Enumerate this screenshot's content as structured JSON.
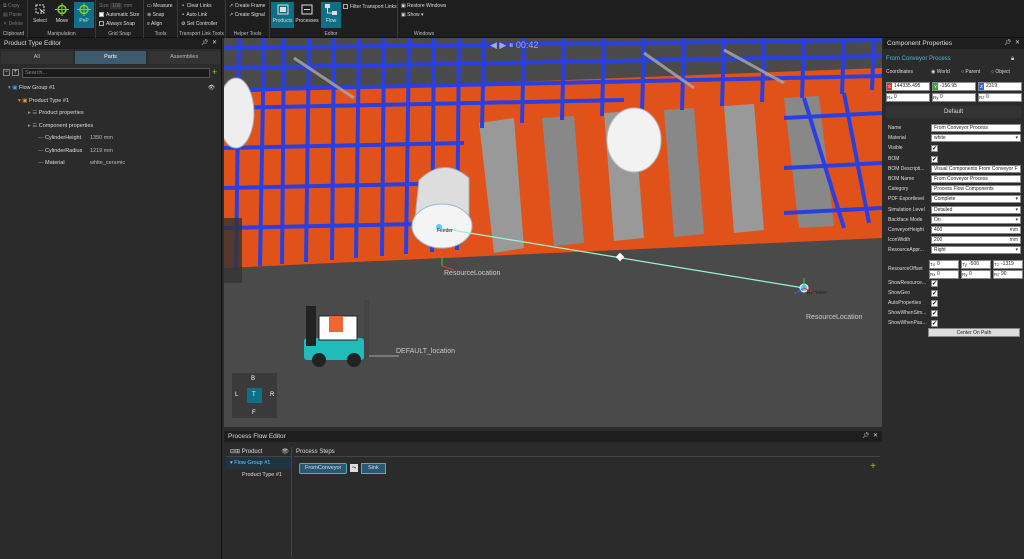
{
  "ribbon": {
    "clipboard": {
      "label": "Clipboard",
      "copy": "Copy",
      "paste": "Paste",
      "delete": "Delete"
    },
    "manipulation": {
      "label": "Manipulation",
      "select": "Select",
      "move": "Move",
      "pnp": "PnP"
    },
    "grid_snap": {
      "label": "Grid Snap",
      "size_label": "Size",
      "size_value": "100",
      "size_unit": "mm",
      "automatic_size": "Automatic Size",
      "always_snap": "Always Snap"
    },
    "tools": {
      "label": "Tools",
      "measure": "Measure",
      "snap": "Snap",
      "align": "Align"
    },
    "transport": {
      "label": "Transport Link Tools",
      "clear_links": "Clear Links",
      "auto_link": "Auto Link",
      "set_controller": "Set Controller"
    },
    "helper": {
      "label": "Helper Tools",
      "create_frame": "Create Frame",
      "create_signal": "Create Signal"
    },
    "editor": {
      "label": "Editor",
      "products": "Products",
      "processes": "Processes",
      "flow": "Flow",
      "filter_links": "Filter Transport Links"
    },
    "windows": {
      "label": "Windows",
      "restore": "Restore Windows",
      "show": "Show ▾"
    }
  },
  "product_editor": {
    "title": "Product Type Editor",
    "tabs": [
      "All",
      "Parts",
      "Assemblies"
    ],
    "search_placeholder": "Search...",
    "tree": [
      {
        "label": "Flow Group #1",
        "indent": 0,
        "icon": "folder"
      },
      {
        "label": "Product Type #1",
        "indent": 1,
        "icon": "product"
      },
      {
        "label": "Product properties",
        "indent": 2,
        "icon": "props"
      },
      {
        "label": "Component properties",
        "indent": 2,
        "icon": "props"
      },
      {
        "label": "CylinderHeight",
        "indent": 3,
        "value": "1350 mm"
      },
      {
        "label": "CylinderRadius",
        "indent": 3,
        "value": "1219 mm"
      },
      {
        "label": "Material",
        "indent": 3,
        "value": "white_ceramic"
      }
    ]
  },
  "viewport": {
    "labels": {
      "resource1": "ResourceLocation",
      "resource2": "ResourceLocation",
      "default_loc": "DEFAULT_location",
      "feeder": "Feeder",
      "receiver": "Receiver",
      "timer": "00:42"
    },
    "navcube": {
      "top": "B",
      "left": "L",
      "center": "T",
      "right": "R",
      "bottom": "F"
    },
    "colors": {
      "rack": "#2a3fe0",
      "floor_orange": "#e0521a",
      "floor": "#474747",
      "path": "#9ff2d5"
    }
  },
  "component_props": {
    "title": "Component Properties",
    "component_name": "From Conveyor Process",
    "coordinates_label": "Coordinates",
    "coord_modes": [
      "World",
      "Parent",
      "Object"
    ],
    "coords": {
      "x": "144335.495",
      "y": "-156.95",
      "z": "2319",
      "rx": "0",
      "ry": "0",
      "rz": "0"
    },
    "tab": "Default",
    "rows": [
      {
        "label": "Name",
        "value": "From Conveyor Process",
        "type": "text"
      },
      {
        "label": "Material",
        "value": "white",
        "type": "select"
      },
      {
        "label": "Visible",
        "value": "✔",
        "type": "check"
      },
      {
        "label": "BOM",
        "value": "✔",
        "type": "check"
      },
      {
        "label": "BOM Descripti...",
        "value": "Visual Components From Conveyor F",
        "type": "text"
      },
      {
        "label": "BOM Name",
        "value": "From Conveyor Process",
        "type": "text"
      },
      {
        "label": "Category",
        "value": "Process Flow Components",
        "type": "text"
      },
      {
        "label": "PDF Exportlevel",
        "value": "Complete",
        "type": "select"
      },
      {
        "label": "Simulation Level",
        "value": "Detailed",
        "type": "select"
      },
      {
        "label": "Backface Mode",
        "value": "On",
        "type": "select"
      },
      {
        "label": "ConveyorHeight",
        "value": "400",
        "unit": "mm",
        "type": "text"
      },
      {
        "label": "IconWidth",
        "value": "200",
        "unit": "mm",
        "type": "text"
      },
      {
        "label": "ResourceAppr...",
        "value": "Right",
        "type": "select"
      }
    ],
    "offset_label": "ResourceOffset",
    "offset": {
      "tx": "0",
      "ty": "-500",
      "tz": "-1319",
      "rx": "0",
      "ry": "0",
      "rz": "90"
    },
    "check_rows": [
      "ShowResource...",
      "ShowGeo",
      "AutoProperties",
      "ShowWhenSim...",
      "ShowWhenPau..."
    ],
    "center_button": "Center On Path"
  },
  "flow_editor": {
    "title": "Process Flow Editor",
    "col_product": "Product",
    "col_steps": "Process Steps",
    "group": "Flow Group #1",
    "product": "Product Type #1",
    "steps": {
      "from": "FromConveyor",
      "sink": "Sink"
    }
  }
}
